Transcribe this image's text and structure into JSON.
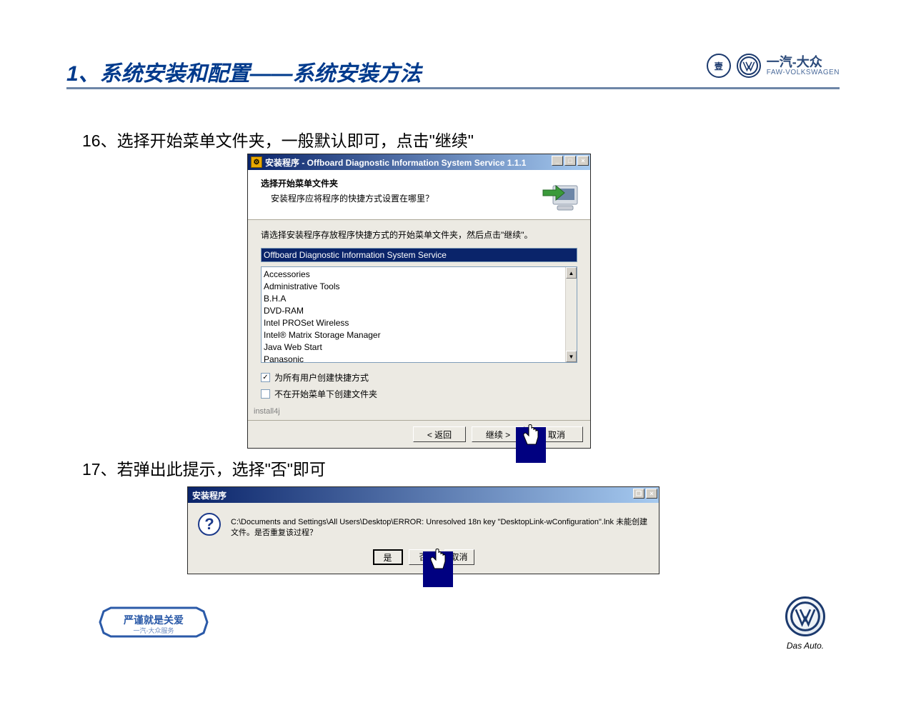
{
  "slide": {
    "title": "1、系统安装和配置——系统安装方法",
    "brand_cn": "一汽-大众",
    "brand_en": "FAW-VOLKSWAGEN",
    "das_auto": "Das Auto."
  },
  "steps": {
    "s16": "16、选择开始菜单文件夹，一般默认即可，点击\"继续\"",
    "s17": "17、若弹出此提示，选择\"否\"即可"
  },
  "installer": {
    "title": "安装程序 - Offboard Diagnostic Information System Service 1.1.1",
    "header_title": "选择开始菜单文件夹",
    "header_sub": "安装程序应将程序的快捷方式设置在哪里？",
    "instruction": "请选择安装程序存放程序快捷方式的开始菜单文件夹，然后点击\"继续\"。",
    "path_value": "Offboard Diagnostic Information System Service",
    "folders": [
      "Accessories",
      "Administrative Tools",
      "B.H.A",
      "DVD-RAM",
      "Intel PROSet Wireless",
      "Intel® Matrix Storage Manager",
      "Java Web Start",
      "Panasonic"
    ],
    "chk_all_users": "为所有用户创建快捷方式",
    "chk_no_folder": "不在开始菜单下创建文件夹",
    "install4j": "install4j",
    "btn_back": "< 返回",
    "btn_continue": "继续 >",
    "btn_cancel": "取消"
  },
  "error_dialog": {
    "title": "安装程序",
    "message": "C:\\Documents and Settings\\All Users\\Desktop\\ERROR: Unresolved 18n key \"DesktopLink-wConfiguration\".lnk 未能创建文件。是否重复该过程？",
    "btn_yes": "是",
    "btn_no": "否",
    "btn_cancel": "取消"
  },
  "footer_badge": {
    "line1": "严谨就是关爱",
    "line2": "一汽-大众服务"
  }
}
